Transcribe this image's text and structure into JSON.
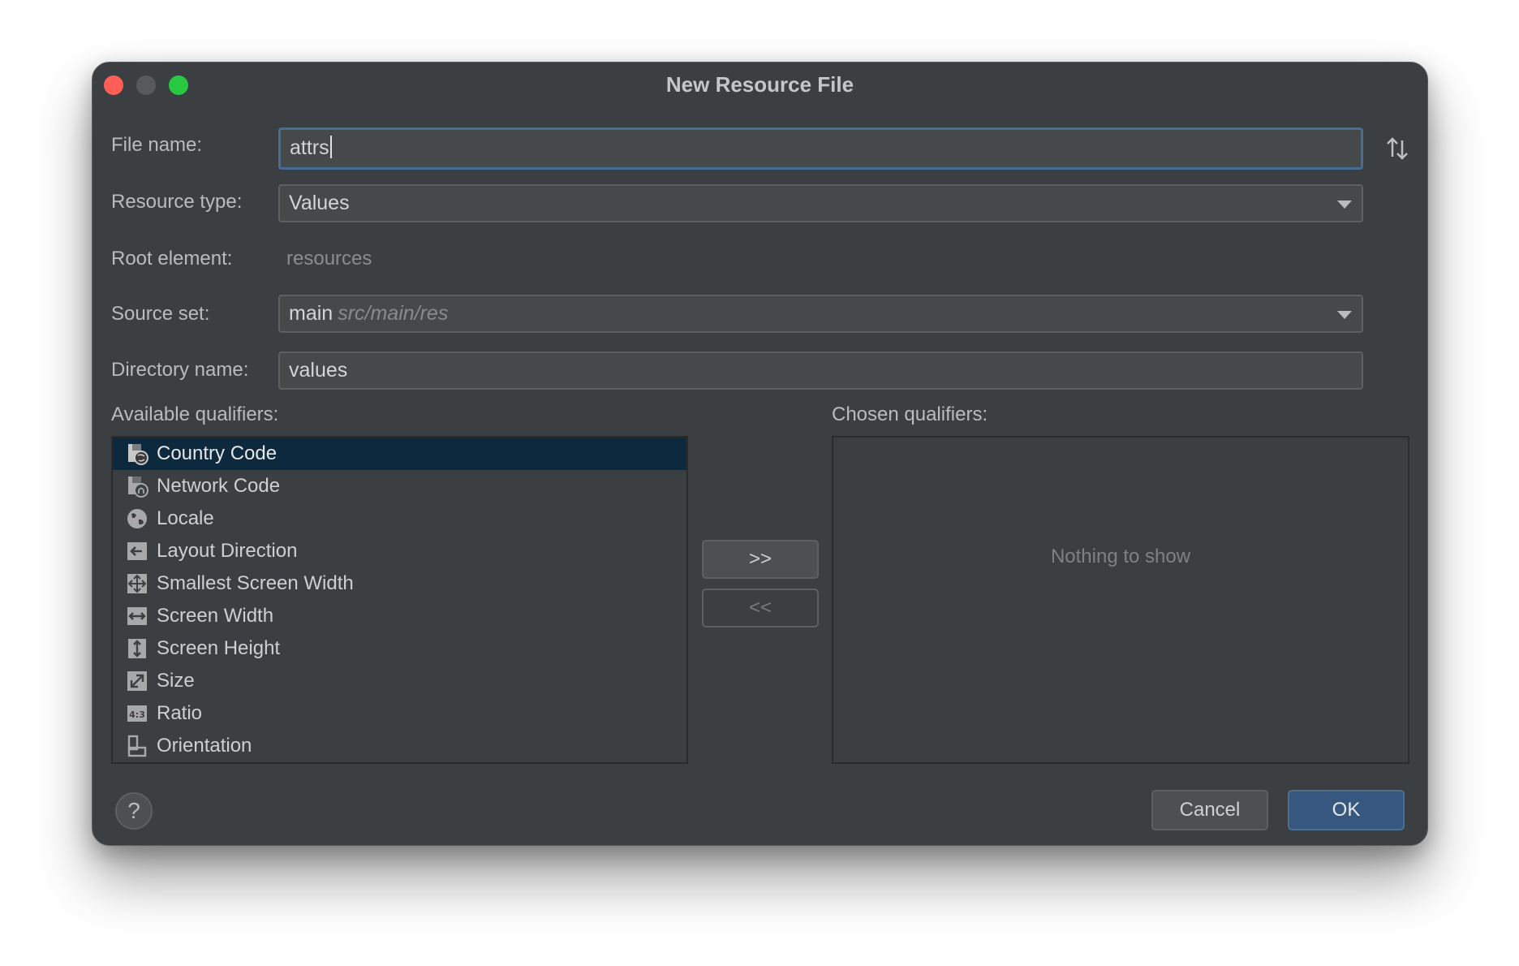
{
  "window": {
    "title": "New Resource File"
  },
  "form": {
    "file_name_label": "File name:",
    "file_name_value": "attrs",
    "resource_type_label": "Resource type:",
    "resource_type_value": "Values",
    "root_element_label": "Root element:",
    "root_element_value": "resources",
    "source_set_label": "Source set:",
    "source_set_value": "main",
    "source_set_path": "src/main/res",
    "directory_name_label": "Directory name:",
    "directory_name_value": "values"
  },
  "available": {
    "label": "Available qualifiers:",
    "items": [
      {
        "label": "Country Code",
        "icon": "country-code-icon",
        "selected": true
      },
      {
        "label": "Network Code",
        "icon": "network-code-icon"
      },
      {
        "label": "Locale",
        "icon": "globe-icon"
      },
      {
        "label": "Layout Direction",
        "icon": "layout-direction-icon"
      },
      {
        "label": "Smallest Screen Width",
        "icon": "smallest-screen-width-icon"
      },
      {
        "label": "Screen Width",
        "icon": "screen-width-icon"
      },
      {
        "label": "Screen Height",
        "icon": "screen-height-icon"
      },
      {
        "label": "Size",
        "icon": "size-icon"
      },
      {
        "label": "Ratio",
        "icon": "ratio-icon"
      },
      {
        "label": "Orientation",
        "icon": "orientation-icon"
      }
    ]
  },
  "transfer": {
    "add_label": ">>",
    "remove_label": "<<"
  },
  "chosen": {
    "label": "Chosen qualifiers:",
    "empty_text": "Nothing to show"
  },
  "footer": {
    "help_label": "?",
    "cancel_label": "Cancel",
    "ok_label": "OK"
  },
  "colors": {
    "dialog_bg": "#3c3f41",
    "selection": "#0d293e",
    "primary_button": "#365880",
    "focus_border": "#466d94"
  }
}
